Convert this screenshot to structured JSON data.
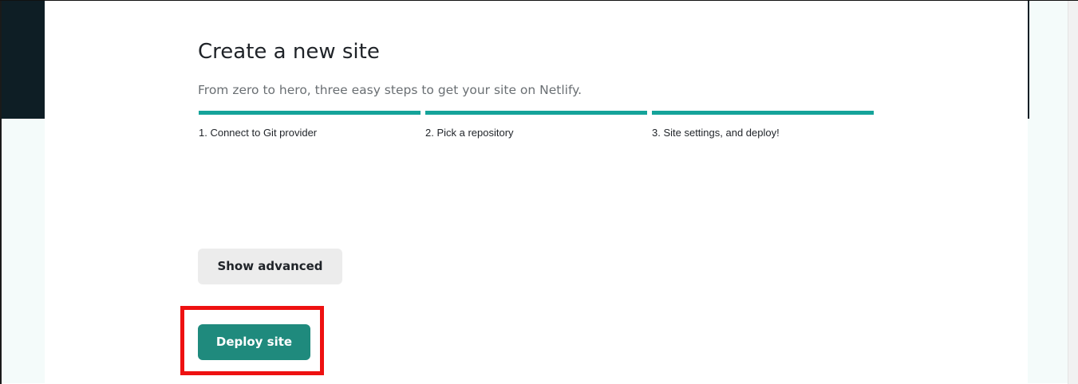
{
  "header": {
    "title": "Create a new site",
    "subtitle": "From zero to hero, three easy steps to get your site on Netlify."
  },
  "steps": [
    {
      "label": "1. Connect to Git provider"
    },
    {
      "label": "2. Pick a repository"
    },
    {
      "label": "3. Site settings, and deploy!"
    }
  ],
  "actions": {
    "show_advanced_label": "Show advanced",
    "deploy_label": "Deploy site"
  },
  "colors": {
    "accent": "#15a39a",
    "primary_button": "#1f8a7d",
    "dark_header": "#0e1e25",
    "highlight": "#ee1111"
  }
}
